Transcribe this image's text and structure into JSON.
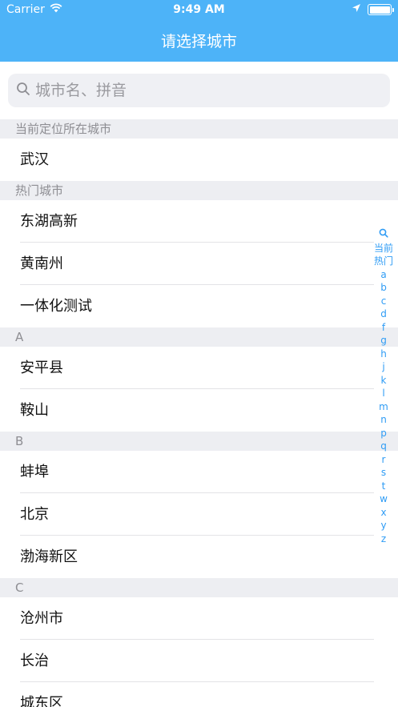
{
  "status_bar": {
    "carrier": "Carrier",
    "time": "9:49 AM"
  },
  "nav": {
    "title": "请选择城市"
  },
  "search": {
    "placeholder": "城市名、拼音"
  },
  "sections": [
    {
      "header": "当前定位所在城市",
      "cities": [
        "武汉"
      ]
    },
    {
      "header": "热门城市",
      "cities": [
        "东湖高新",
        "黄南州",
        "一体化测试"
      ]
    },
    {
      "header": "A",
      "cities": [
        "安平县",
        "鞍山"
      ]
    },
    {
      "header": "B",
      "cities": [
        "蚌埠",
        "北京",
        "渤海新区"
      ]
    },
    {
      "header": "C",
      "cities": [
        "沧州市",
        "长治",
        "城东区"
      ]
    }
  ],
  "index": [
    "当前",
    "热门",
    "a",
    "b",
    "c",
    "d",
    "f",
    "g",
    "h",
    "j",
    "k",
    "l",
    "m",
    "n",
    "p",
    "q",
    "r",
    "s",
    "t",
    "w",
    "x",
    "y",
    "z"
  ],
  "colors": {
    "nav_bg": "#4db3f8",
    "index_text": "#2f9cf5",
    "section_bg": "#edeef2"
  }
}
